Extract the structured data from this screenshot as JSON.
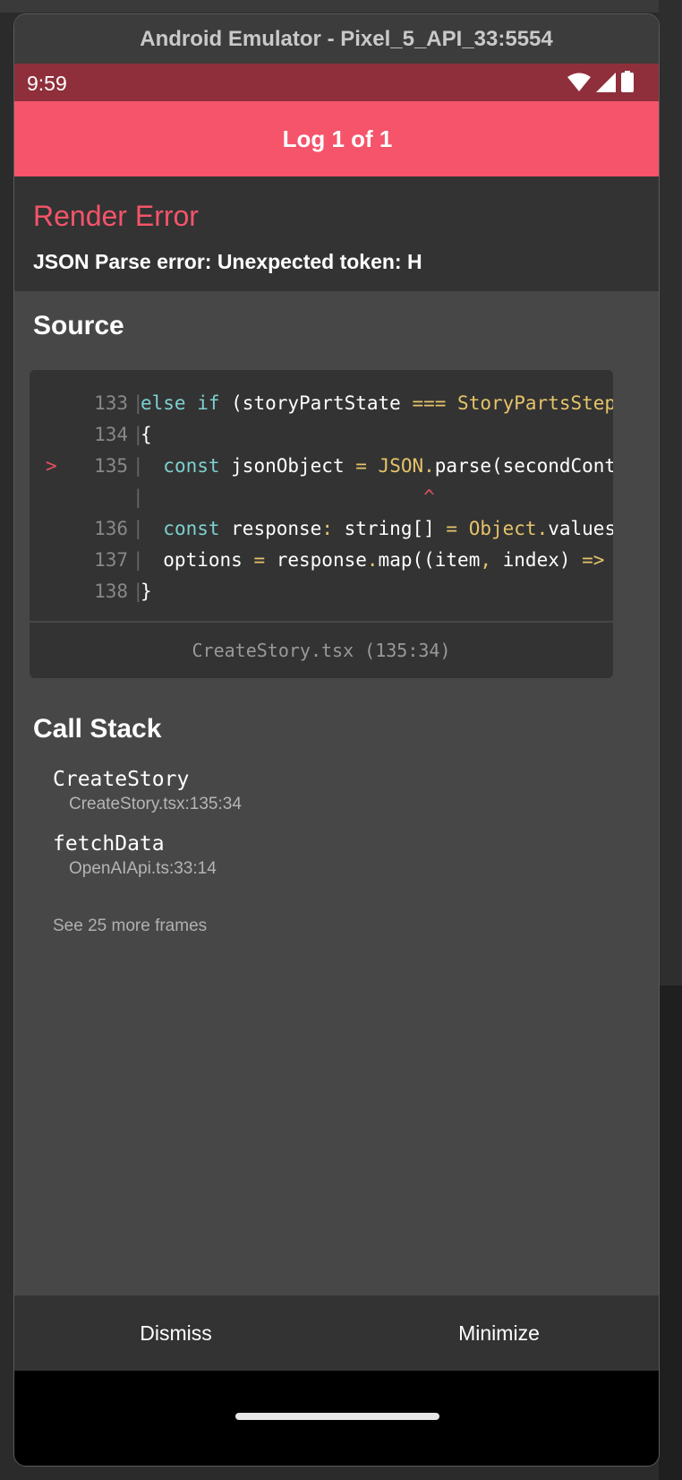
{
  "window": {
    "title": "Android Emulator - Pixel_5_API_33:5554"
  },
  "statusbar": {
    "time": "9:59",
    "icons": [
      "wifi-icon",
      "signal-icon",
      "battery-icon"
    ]
  },
  "appbar": {
    "title": "Log 1 of 1"
  },
  "error": {
    "title": "Render Error",
    "message": "JSON Parse error: Unexpected token: H"
  },
  "source": {
    "title": "Source",
    "lines": [
      {
        "marker": "",
        "num": "133",
        "sep": "|",
        "tokens": [
          [
            "kw",
            "else if"
          ],
          [
            "",
            " (storyPartState "
          ],
          [
            "op",
            "==="
          ],
          [
            "",
            " "
          ],
          [
            "cls",
            "StoryPartsStep"
          ]
        ]
      },
      {
        "marker": "",
        "num": "134",
        "sep": "|",
        "tokens": [
          [
            "",
            "{"
          ]
        ]
      },
      {
        "marker": ">",
        "num": "135",
        "sep": "|",
        "tokens": [
          [
            "",
            "  "
          ],
          [
            "kw",
            "const"
          ],
          [
            "",
            " jsonObject "
          ],
          [
            "op",
            "="
          ],
          [
            "",
            " "
          ],
          [
            "cls",
            "JSON"
          ],
          [
            "op",
            "."
          ],
          [
            "",
            "parse(secondCont"
          ]
        ]
      },
      {
        "marker": "",
        "num": "",
        "sep": "|",
        "tokens": [
          [
            "",
            "                         "
          ],
          [
            "caret",
            "^"
          ]
        ]
      },
      {
        "marker": "",
        "num": "136",
        "sep": "|",
        "tokens": [
          [
            "",
            "  "
          ],
          [
            "kw",
            "const"
          ],
          [
            "",
            " response"
          ],
          [
            "op",
            ":"
          ],
          [
            "",
            " string[] "
          ],
          [
            "op",
            "="
          ],
          [
            "",
            " "
          ],
          [
            "cls",
            "Object"
          ],
          [
            "op",
            "."
          ],
          [
            "",
            "values"
          ]
        ]
      },
      {
        "marker": "",
        "num": "137",
        "sep": "|",
        "tokens": [
          [
            "",
            "  options "
          ],
          [
            "op",
            "="
          ],
          [
            "",
            " response"
          ],
          [
            "op",
            "."
          ],
          [
            "",
            "map((item"
          ],
          [
            "op",
            ","
          ],
          [
            "",
            " index) "
          ],
          [
            "op",
            "=>"
          ]
        ]
      },
      {
        "marker": "",
        "num": "138",
        "sep": "|",
        "tokens": [
          [
            "",
            "}"
          ]
        ]
      }
    ],
    "file_location": "CreateStory.tsx (135:34)"
  },
  "callstack": {
    "title": "Call Stack",
    "frames": [
      {
        "name": "CreateStory",
        "file": "CreateStory.tsx:135:34"
      },
      {
        "name": "fetchData",
        "file": "OpenAIApi.ts:33:14"
      }
    ],
    "more": "See 25 more frames"
  },
  "bottom": {
    "dismiss": "Dismiss",
    "minimize": "Minimize"
  },
  "colors": {
    "accent": "#f5546a",
    "statusbar": "#8f2f3b",
    "panel": "#333333",
    "background": "#474747"
  }
}
